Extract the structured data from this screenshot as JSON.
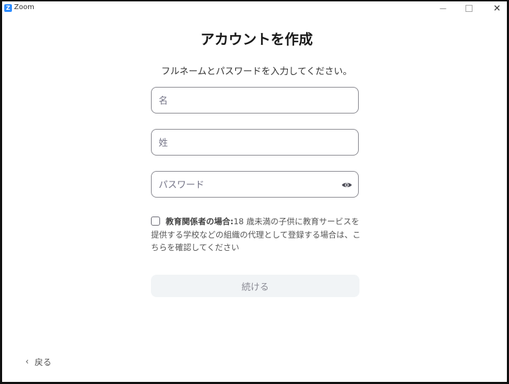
{
  "window": {
    "app_title": "Zoom",
    "logo_letter": "Z",
    "minimize": "—",
    "close": "✕"
  },
  "form": {
    "heading": "アカウントを作成",
    "subheading": "フルネームとパスワードを入力してください。",
    "first_name_placeholder": "名",
    "last_name_placeholder": "姓",
    "password_placeholder": "パスワード",
    "password_toggle_icon": "eye-icon",
    "education": {
      "checked": false,
      "label_bold": "教育関係者の場合:",
      "label_text": "18 歳未満の子供に教育サービスを提供する学校などの組織の代理として登録する場合は、こちらを確認してください"
    },
    "continue_label": "続ける",
    "back_label": "戻る"
  },
  "colors": {
    "accent": "#2D8CFF",
    "button_disabled_bg": "#f1f4f6",
    "button_disabled_text": "#8b8b95",
    "field_border": "#8c8c93"
  }
}
